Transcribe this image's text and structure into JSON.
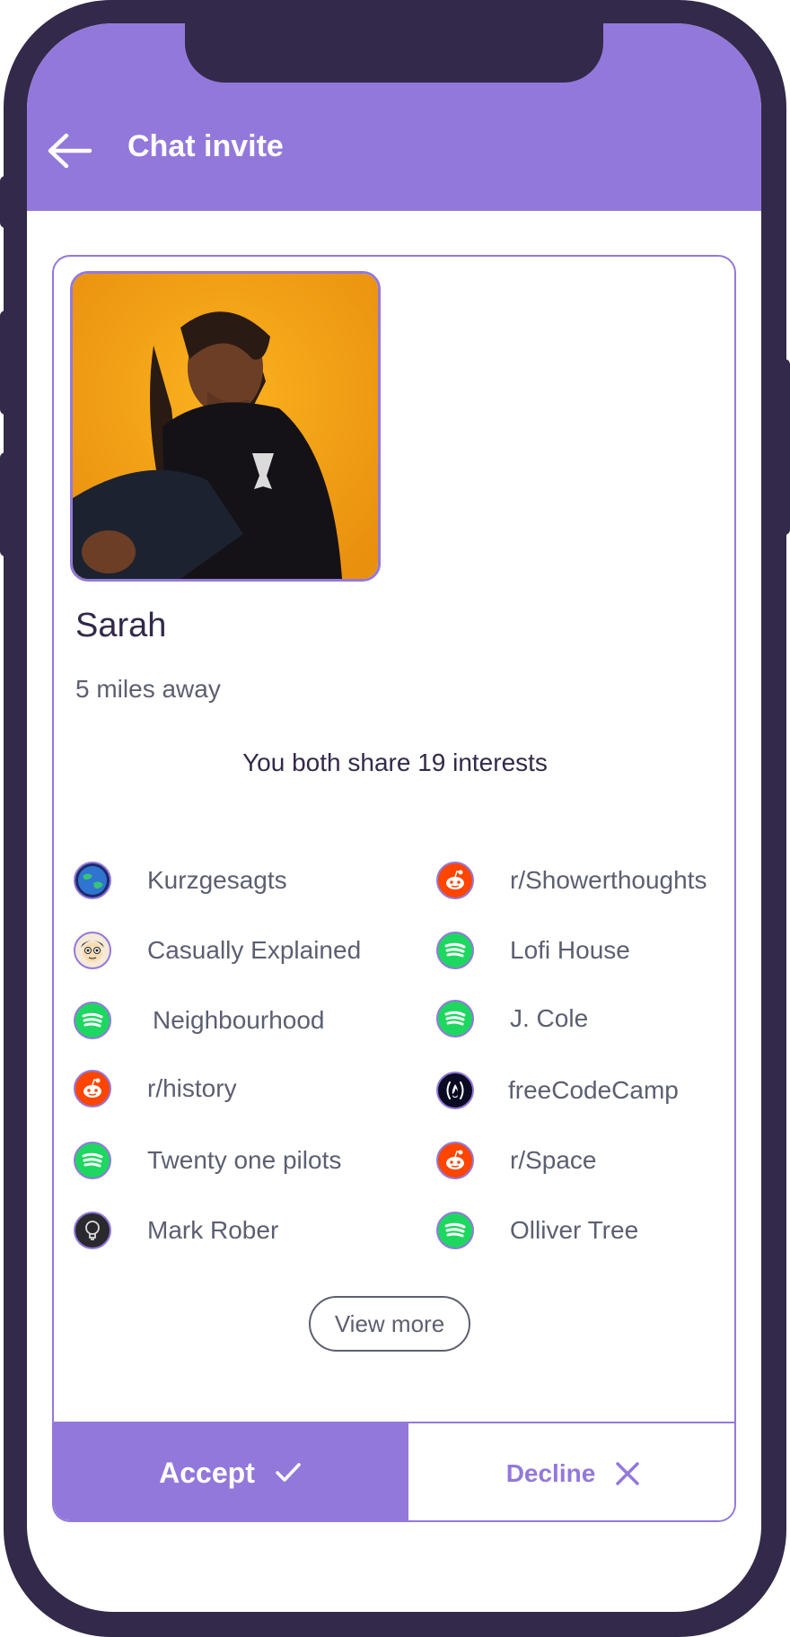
{
  "header": {
    "title": "Chat invite",
    "back_icon": "arrow-left-icon"
  },
  "profile": {
    "name": "Sarah",
    "distance": "5 miles away",
    "shared": "You both share 19 interests"
  },
  "interests": [
    {
      "label": "Kurzgesagts",
      "icon": "earth-icon"
    },
    {
      "label": "r/Showerthoughts",
      "icon": "reddit-icon"
    },
    {
      "label": "Casually Explained",
      "icon": "cartoon-face-icon"
    },
    {
      "label": "Lofi House",
      "icon": "spotify-icon"
    },
    {
      "label": "Neighbourhood",
      "icon": "spotify-icon"
    },
    {
      "label": "J. Cole",
      "icon": "spotify-icon"
    },
    {
      "label": "r/history",
      "icon": "reddit-icon"
    },
    {
      "label": "freeCodeCamp",
      "icon": "flame-icon"
    },
    {
      "label": "Twenty one pilots",
      "icon": "spotify-icon"
    },
    {
      "label": "r/Space",
      "icon": "reddit-icon"
    },
    {
      "label": "Mark Rober",
      "icon": "lightbulb-icon"
    },
    {
      "label": "Olliver Tree",
      "icon": "spotify-icon"
    }
  ],
  "actions": {
    "view_more": "View more",
    "accept": "Accept",
    "decline": "Decline"
  },
  "colors": {
    "primary": "#9378db",
    "dark": "#33294a",
    "spotify": "#1ed760",
    "reddit": "#ff4500"
  }
}
